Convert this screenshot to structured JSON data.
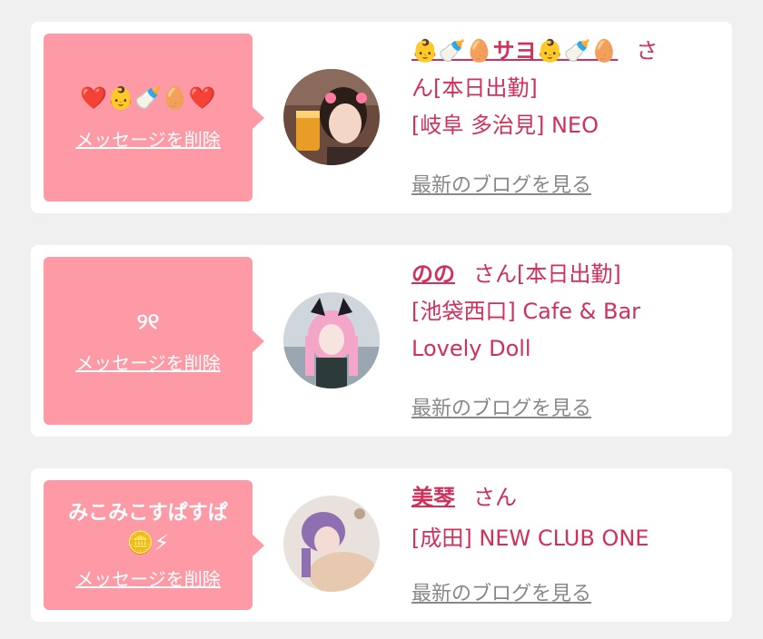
{
  "entries": [
    {
      "message": "❤️👶🍼🥚❤️",
      "delete_label": "メッセージを削除",
      "name": "👶🍼🥚サヨ👶🍼🥚",
      "honorific": "さ",
      "line1_rest": "ん[本日出勤]",
      "shop_line": "[岐阜 多治見] NEO",
      "blog_label": "最新のブログを見る"
    },
    {
      "message": "୨୧",
      "delete_label": "メッセージを削除",
      "name": "のの",
      "honorific": "さん[本日出勤]",
      "shop_line1": "[池袋西口] Cafe & Bar",
      "shop_line2": "Lovely Doll",
      "blog_label": "最新のブログを見る"
    },
    {
      "message_line1": "みこみこすぱすぱ",
      "message_line2": "🪙⚡",
      "delete_label": "メッセージを削除",
      "name": "美琴",
      "honorific": "さん",
      "shop_line": "[成田] NEW CLUB ONE",
      "blog_label": "最新のブログを見る"
    }
  ],
  "colors": {
    "bubble": "#fe9aa6",
    "accent_text": "#d0305a",
    "link_gray": "#888888",
    "background": "#f0f0f0"
  }
}
